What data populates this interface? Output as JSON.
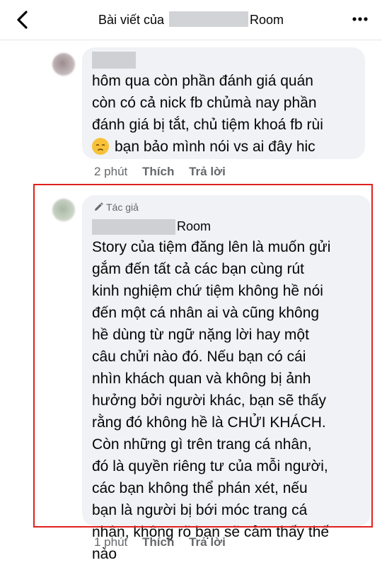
{
  "header": {
    "title_prefix": "Bài viết của",
    "title_suffix": "Room"
  },
  "comments": [
    {
      "lines": [
        "hôm qua còn phần đánh giá quán",
        "còn có cả nick fb chủmà nay phần",
        "đánh giá bị tắt, chủ tiệm khoá fb rùi",
        "bạn bảo mình nói vs ai đây hic"
      ],
      "time": "2 phút",
      "like_label": "Thích",
      "reply_label": "Trả lời"
    },
    {
      "badge": "Tác giả",
      "author_suffix": "Room",
      "lines": [
        "Story của tiệm đăng lên là muốn gửi",
        "gắm đến tất cả các bạn cùng rút",
        "kinh nghiệm chứ tiệm không hề nói",
        "đến một cá nhân ai và cũng không",
        "hề dùng từ ngữ nặng lời hay một",
        "câu chửi nào đó. Nếu bạn có cái",
        "nhìn khách quan và không bị ảnh",
        "hưởng bởi người khác, bạn sẽ thấy",
        "rằng đó không hề là CHỬI KHÁCH.",
        "Còn những gì trên trang cá nhân,",
        "đó là quyền riêng tư của mỗi người,",
        "các bạn không thể phán xét, nếu",
        "bạn là người bị bới móc trang cá",
        "nhân, không rõ bạn sẽ cảm thấy thế",
        "nào"
      ],
      "time": "1 phút",
      "like_label": "Thích",
      "reply_label": "Trả lời"
    }
  ],
  "colors": {
    "bubble": "#f0f2f5",
    "highlight": "#e0201f",
    "meta": "#65676b"
  }
}
